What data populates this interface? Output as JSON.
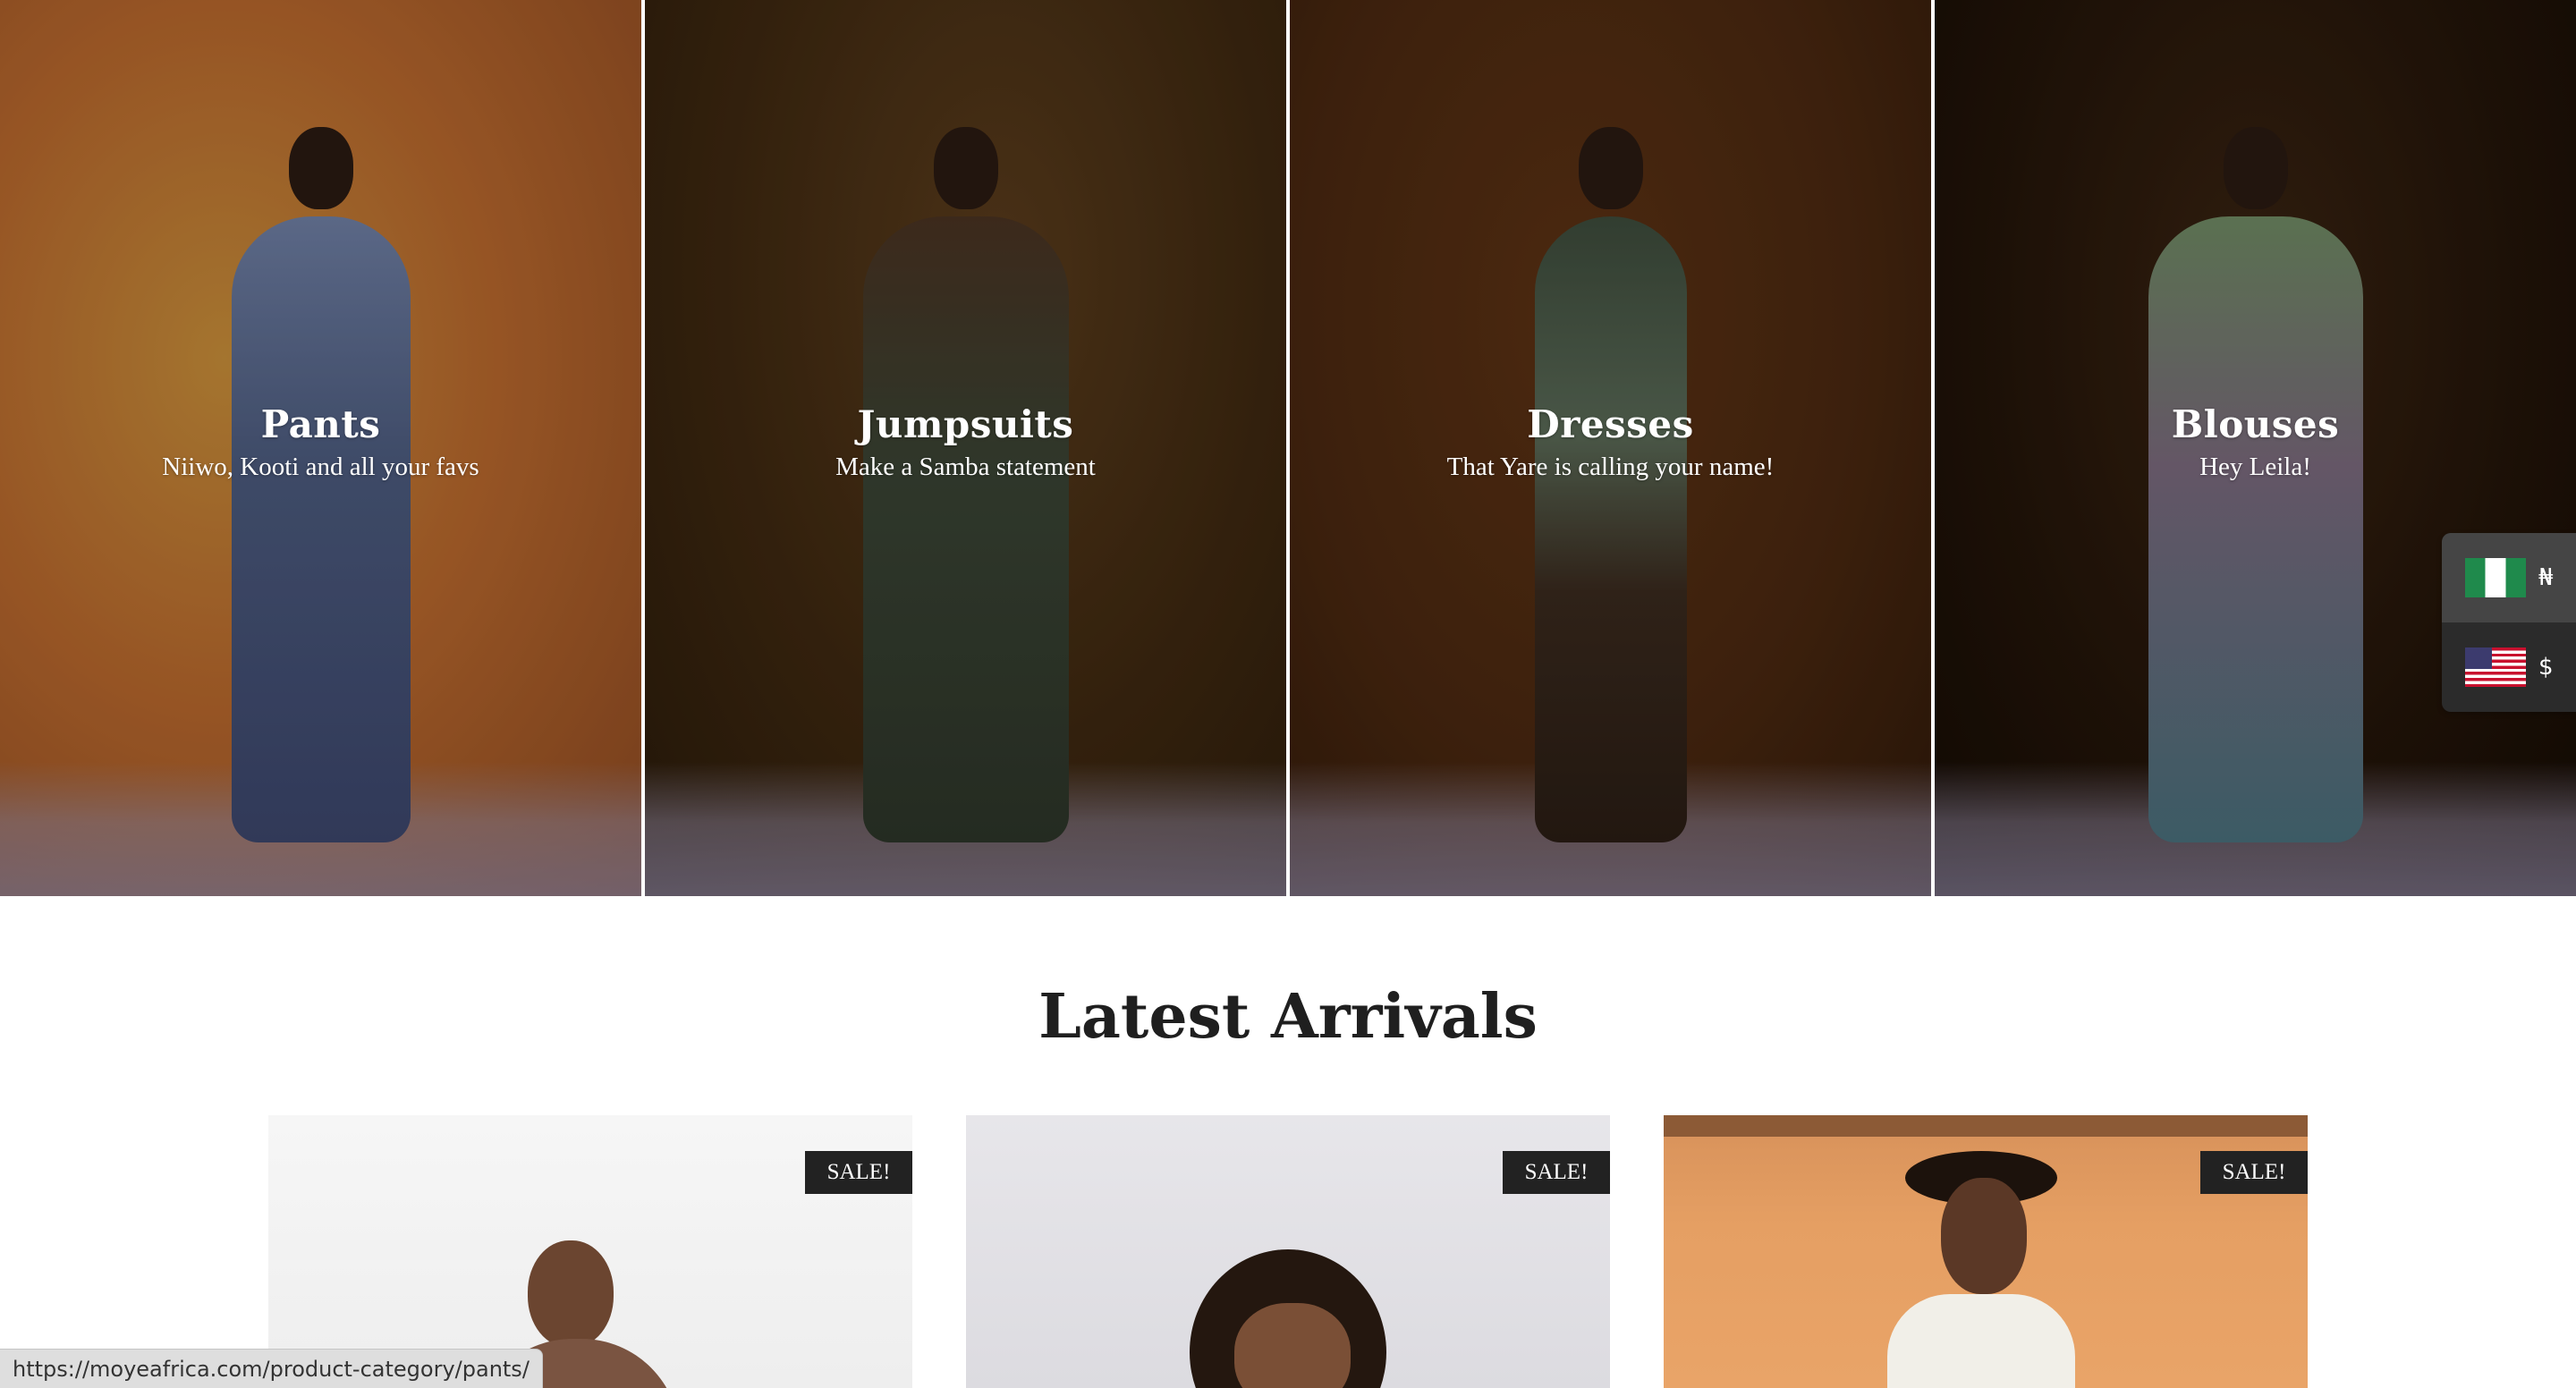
{
  "categories": [
    {
      "title": "Pants",
      "subtitle": "Niiwo, Kooti and all your favs"
    },
    {
      "title": "Jumpsuits",
      "subtitle": "Make a Samba statement"
    },
    {
      "title": "Dresses",
      "subtitle": "That Yare is calling your name!"
    },
    {
      "title": "Blouses",
      "subtitle": "Hey Leila!"
    }
  ],
  "currency_switcher": {
    "options": [
      {
        "flag": "nigeria-flag",
        "symbol": "₦",
        "active": true
      },
      {
        "flag": "usa-flag",
        "symbol": "$",
        "active": false
      }
    ]
  },
  "latest_arrivals": {
    "heading": "Latest Arrivals",
    "products": [
      {
        "badge": "SALE!"
      },
      {
        "badge": "SALE!"
      },
      {
        "badge": "SALE!"
      }
    ]
  },
  "status_bar": {
    "url": "https://moyeafrica.com/product-category/pants/"
  },
  "colors": {
    "sale_badge_bg": "#222222",
    "switcher_bg": "#2b2b2b",
    "heading_text": "#1f1f1f"
  }
}
